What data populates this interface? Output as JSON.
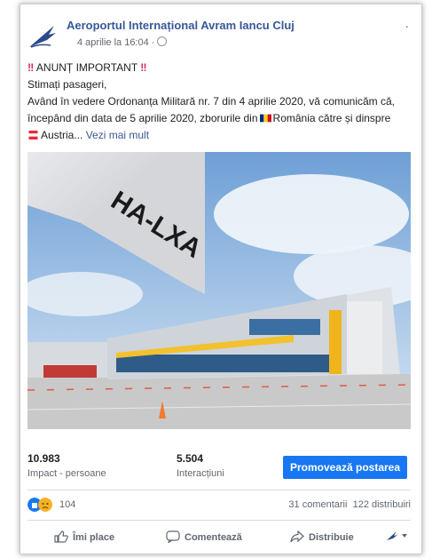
{
  "post": {
    "page_name": "Aeroportul Internațional Avram Iancu Cluj",
    "timestamp": "4 aprilie la 16:04 ·",
    "menu_glyph": "·",
    "title": "ANUNȚ IMPORTANT",
    "warn_glyph": "‼",
    "greeting": "Stimați pasageri,",
    "line1": "Având în vedere Ordonanța Militară nr. 7 din 4 aprilie 2020, vă comunicăm că,",
    "line2_pre": "începând din data de 5 aprilie 2020, zborurile din",
    "line2_post": "România către și dinspre",
    "line3": "Austria...",
    "see_more": "Vezi mai mult",
    "image_registration": "HA-LXA"
  },
  "stats": {
    "reach_value": "10.983",
    "reach_label": "Impact - persoane",
    "interactions_value": "5.504",
    "interactions_label": "Interacțiuni",
    "promote_label": "Promovează postarea"
  },
  "reactions": {
    "count": "104",
    "comments": "31 comentarii",
    "shares": "122 distribuiri"
  },
  "actions": {
    "like": "Îmi place",
    "comment": "Comentează",
    "share": "Distribuie"
  },
  "colors": {
    "link": "#385898",
    "promote": "#1877f2"
  }
}
